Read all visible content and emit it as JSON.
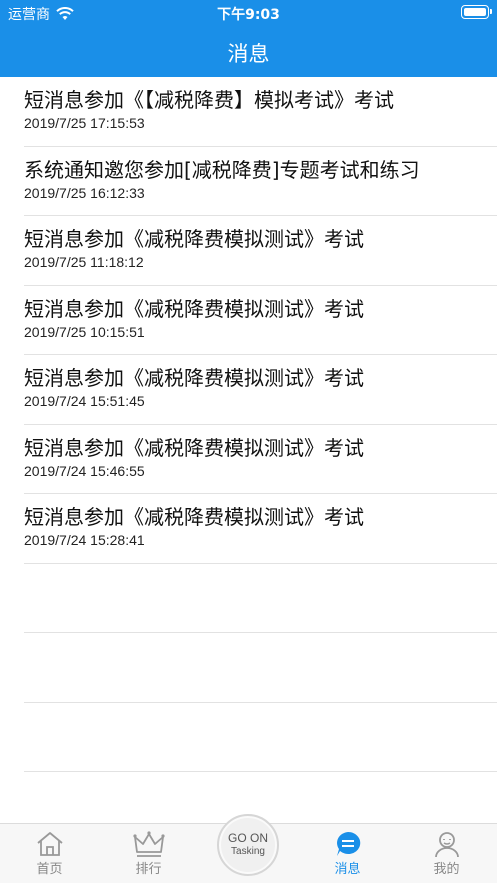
{
  "status_bar": {
    "carrier": "运营商",
    "time": "下午9:03"
  },
  "header": {
    "title": "消息"
  },
  "messages": [
    {
      "title": "短消息参加《【减税降费】模拟考试》考试",
      "time": "2019/7/25 17:15:53"
    },
    {
      "title": "系统通知邀您参加[减税降费]专题考试和练习",
      "time": "2019/7/25 16:12:33"
    },
    {
      "title": "短消息参加《减税降费模拟测试》考试",
      "time": "2019/7/25 11:18:12"
    },
    {
      "title": "短消息参加《减税降费模拟测试》考试",
      "time": "2019/7/25 10:15:51"
    },
    {
      "title": "短消息参加《减税降费模拟测试》考试",
      "time": "2019/7/24 15:51:45"
    },
    {
      "title": "短消息参加《减税降费模拟测试》考试",
      "time": "2019/7/24 15:46:55"
    },
    {
      "title": "短消息参加《减税降费模拟测试》考试",
      "time": "2019/7/24 15:28:41"
    }
  ],
  "tabbar": {
    "home": {
      "label": "首页",
      "icon": "home-icon"
    },
    "rank": {
      "label": "排行",
      "icon": "crown-icon"
    },
    "go_on": {
      "line1": "GO ON",
      "line2": "Tasking"
    },
    "messages": {
      "label": "消息",
      "icon": "chat-icon"
    },
    "mine": {
      "label": "我的",
      "icon": "user-icon"
    }
  },
  "colors": {
    "accent": "#1a8fe8",
    "divider": "#e2e2e2"
  }
}
